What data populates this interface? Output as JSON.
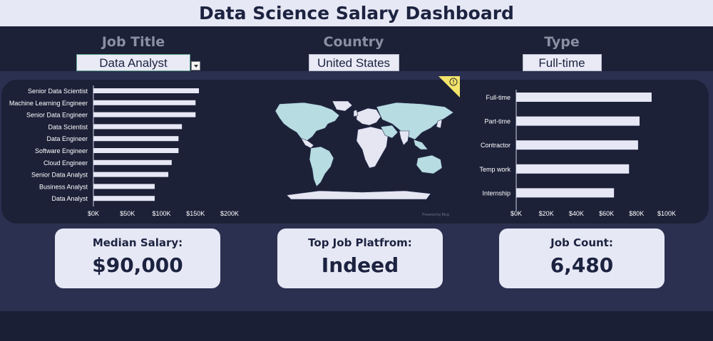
{
  "title": "Data Science Salary Dashboard",
  "filters": {
    "job_title": {
      "label": "Job Title",
      "value": "Data Analyst"
    },
    "country": {
      "label": "Country",
      "value": "United States"
    },
    "type": {
      "label": "Type",
      "value": "Full-time"
    }
  },
  "map": {
    "powered_by": "Powered by Bing",
    "warning_icon": "info-warning-icon"
  },
  "kpis": {
    "median_salary": {
      "label": "Median Salary:",
      "value": "$90,000"
    },
    "top_platform": {
      "label": "Top Job Platfrom:",
      "value": "Indeed"
    },
    "job_count": {
      "label": "Job Count:",
      "value": "6,480"
    }
  },
  "colors": {
    "bar": "#e7e8f5",
    "panel": "#1c2138",
    "background": "#2b3050",
    "land": "#e6e6f3",
    "land_highlight": "#b7dce1"
  },
  "chart_data": [
    {
      "type": "bar",
      "orientation": "horizontal",
      "categories": [
        "Senior Data Scientist",
        "Machine Learning Engineer",
        "Senior Data Engineer",
        "Data Scientist",
        "Data Engineer",
        "Software Engineer",
        "Cloud Engineer",
        "Senior Data Analyst",
        "Business Analyst",
        "Data Analyst"
      ],
      "values": [
        155000,
        150000,
        150000,
        130000,
        125000,
        125000,
        115000,
        110000,
        90000,
        90000
      ],
      "xlim": [
        0,
        200000
      ],
      "xticks": [
        "$0K",
        "$50K",
        "$100K",
        "$150K",
        "$200K"
      ],
      "grid": false
    },
    {
      "type": "bar",
      "orientation": "horizontal",
      "categories": [
        "Full-time",
        "Part-time",
        "Contractor",
        "Temp work",
        "Internship"
      ],
      "values": [
        90000,
        82000,
        81000,
        75000,
        65000
      ],
      "xlim": [
        0,
        100000
      ],
      "xticks": [
        "$0K",
        "$20K",
        "$40K",
        "$60K",
        "$80K",
        "$100K"
      ],
      "grid": false
    }
  ]
}
